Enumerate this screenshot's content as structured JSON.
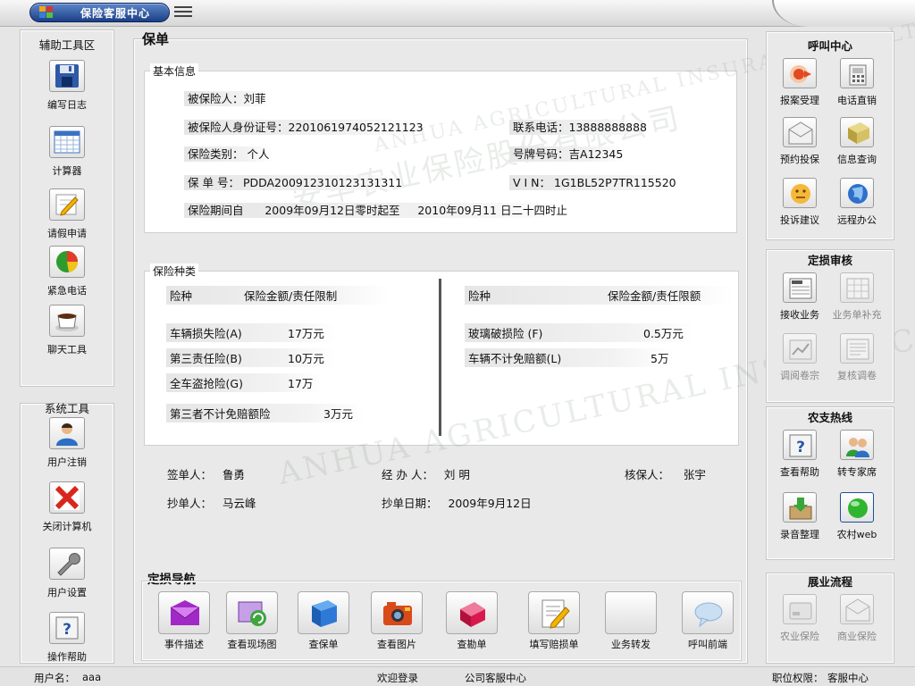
{
  "window": {
    "title": "保险客服中心"
  },
  "left_tools": {
    "title": "辅助工具区",
    "items": [
      {
        "label": "编写日志",
        "icon": "floppy-disk-icon"
      },
      {
        "label": "计算器",
        "icon": "calculator-icon"
      },
      {
        "label": "请假申请",
        "icon": "pencil-note-icon"
      },
      {
        "label": "紧急电话",
        "icon": "pie-chart-icon"
      },
      {
        "label": "聊天工具",
        "icon": "coffee-cup-icon"
      }
    ]
  },
  "system_tools": {
    "title": "系统工具",
    "items": [
      {
        "label": "用户注销",
        "icon": "user-icon"
      },
      {
        "label": "关闭计算机",
        "icon": "close-x-icon"
      },
      {
        "label": "用户设置",
        "icon": "wrench-icon"
      },
      {
        "label": "操作帮助",
        "icon": "help-icon"
      }
    ]
  },
  "policy": {
    "heading": "保单",
    "basic": {
      "legend": "基本信息",
      "insured_label": "被保险人：",
      "insured_name": "刘菲",
      "id_label": "被保险人身份证号：",
      "id_value": "2201061974052121123",
      "phone_label": "联系电话：",
      "phone_value": "13888888888",
      "type_label": "保险类别：",
      "type_value": "个人",
      "plate_label": "号牌号码：",
      "plate_value": "吉A12345",
      "no_label": "保 单 号：",
      "no_value": "PDDA200912310123131311",
      "vin_label": "V  I  N：",
      "vin_value": "1G1BL52P7TR115520",
      "period_label": "保险期间自",
      "period_from": "2009年09月12日零时起至",
      "period_to": "2010年09月11 日二十四时止"
    },
    "coverage": {
      "legend": "保险种类",
      "col_kind": "险种",
      "col_amount": "保险金额/责任限制",
      "col_kind_right": "险种",
      "col_amount_right": "保险金额/责任限额",
      "left_rows": [
        {
          "name": "车辆损失险(A)",
          "amount": "17万元"
        },
        {
          "name": "第三责任险(B)",
          "amount": "10万元"
        },
        {
          "name": "全车盗抢险(G)",
          "amount": "17万"
        },
        {
          "name": "第三者不计免赔额险",
          "amount": "3万元"
        }
      ],
      "right_rows": [
        {
          "name": "玻璃破损险 (F)",
          "amount": "0.5万元"
        },
        {
          "name": "车辆不计免赔额(L)",
          "amount": "5万"
        }
      ]
    },
    "signatures": {
      "signer_label": "签单人：",
      "signer": "鲁勇",
      "handler_label": "经 办 人：",
      "handler": "刘  明",
      "underwriter_label": "核保人：",
      "underwriter": "张宇",
      "copier_label": "抄单人：",
      "copier": "马云峰",
      "copy_date_label": "抄单日期：",
      "copy_date": "2009年9月12日"
    },
    "watermark_cn": "安华农业保险股份有限公司",
    "watermark_en": "ANHUA AGRICULTURAL INSURANCE CO.,LTD"
  },
  "nav": {
    "title": "定损导航",
    "items": [
      {
        "label": "事件描述",
        "icon": "envelope-icon"
      },
      {
        "label": "查看现场图",
        "icon": "photo-refresh-icon"
      },
      {
        "label": "查保单",
        "icon": "binder-icon"
      },
      {
        "label": "查看图片",
        "icon": "camera-icon"
      },
      {
        "label": "查勘单",
        "icon": "red-book-icon"
      },
      {
        "label": "填写赔损单",
        "icon": "edit-document-icon"
      },
      {
        "label": "业务转发",
        "icon": "blank-icon"
      },
      {
        "label": "呼叫前端",
        "icon": "speech-bubble-icon"
      }
    ]
  },
  "call_center": {
    "title": "呼叫中心",
    "items": [
      {
        "label": "报案受理",
        "icon": "report-icon"
      },
      {
        "label": "电话直销",
        "icon": "phone-icon"
      },
      {
        "label": "预约投保",
        "icon": "mail-open-icon"
      },
      {
        "label": "信息查询",
        "icon": "book-icon"
      },
      {
        "label": "投诉建议",
        "icon": "smiley-icon"
      },
      {
        "label": "远程办公",
        "icon": "globe-icon"
      }
    ]
  },
  "damage_review": {
    "title": "定损审核",
    "items": [
      {
        "label": "接收业务",
        "icon": "news-icon"
      },
      {
        "label": "业务单补充",
        "icon": "grid-doc-icon"
      },
      {
        "label": "调阅卷宗",
        "icon": "folder-chart-icon"
      },
      {
        "label": "复核调卷",
        "icon": "list-doc-icon"
      }
    ]
  },
  "hotline": {
    "title": "农支热线",
    "items": [
      {
        "label": "查看帮助",
        "icon": "help-icon"
      },
      {
        "label": "转专家席",
        "icon": "users-icon"
      },
      {
        "label": "录音整理",
        "icon": "download-box-icon"
      },
      {
        "label": "农村web",
        "icon": "green-ball-icon"
      }
    ]
  },
  "business": {
    "title": "展业流程",
    "items": [
      {
        "label": "农业保险",
        "icon": "drive-icon"
      },
      {
        "label": "商业保险",
        "icon": "mail-open-icon"
      }
    ]
  },
  "status": {
    "user_label": "用户名：",
    "user": "aaa",
    "welcome": "欢迎登录",
    "company": "公司客服中心",
    "perm_label": "职位权限：",
    "perm": "客服中心"
  }
}
